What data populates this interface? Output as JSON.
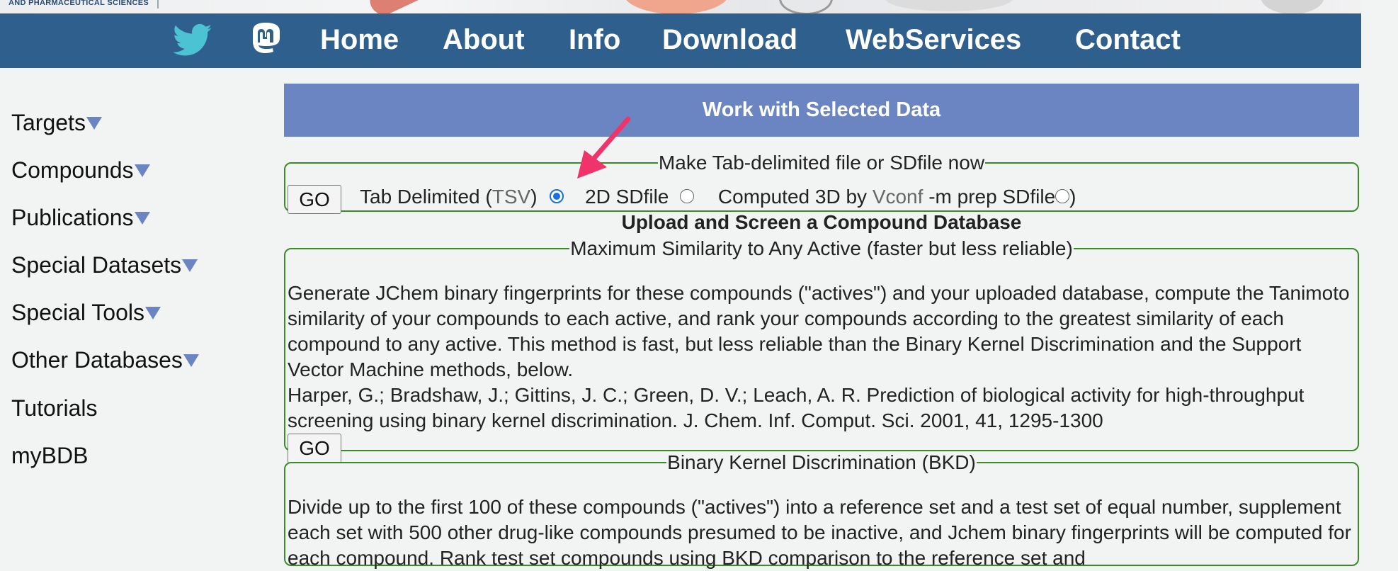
{
  "banner": {
    "logo_text": "AND PHARMACEUTICAL SCIENCES"
  },
  "nav": {
    "social": [
      "twitter-icon",
      "mastodon-icon"
    ],
    "links": [
      "Home",
      "About",
      "Info",
      "Download",
      "WebServices",
      "Contact"
    ]
  },
  "sidebar": {
    "items": [
      {
        "label": "Targets"
      },
      {
        "label": "Compounds"
      },
      {
        "label": "Publications"
      },
      {
        "label": "Special Datasets"
      },
      {
        "label": "Special Tools"
      },
      {
        "label": "Other Databases"
      },
      {
        "label": "Tutorials"
      },
      {
        "label": "myBDB"
      }
    ]
  },
  "main": {
    "header": "Work with Selected Data",
    "make_file": {
      "legend": "Make Tab-delimited file or SDfile now",
      "go": "GO",
      "options": {
        "tsv_prefix": "Tab Delimited (",
        "tsv_abbr": "TSV",
        "tsv_suffix": ")",
        "sdf2d": "2D SDfile",
        "sdf3d_prefix": "Computed 3D by ",
        "sdf3d_tool": "Vconf",
        "sdf3d_suffix": " -m prep SDfile",
        "close_paren": ")"
      },
      "selected": "tsv"
    },
    "upload_title": "Upload and Screen a Compound Database",
    "max_sim": {
      "legend": "Maximum Similarity to Any Active (faster but less reliable)",
      "text": "Generate JChem binary fingerprints for these compounds (\"actives\") and your uploaded database, compute the Tanimoto similarity of your compounds to each active, and rank your compounds according to the greatest similarity of each compound to any active. This method is fast, but less reliable than the Binary Kernel Discrimination and the Support Vector Machine methods, below.",
      "citation": "Harper, G.; Bradshaw, J.; Gittins, J. C.; Green, D. V.; Leach, A. R. Prediction of biological activity for high-throughput screening using binary kernel discrimination. J. Chem. Inf. Comput. Sci. 2001, 41, 1295-1300",
      "go": "GO"
    },
    "bkd": {
      "legend": "Binary Kernel Discrimination (BKD)",
      "text": "Divide up to the first 100 of these compounds (\"actives\") into a reference set and a test set of equal number, supplement each set with 500 other drug-like compounds presumed to be inactive, and Jchem binary fingerprints will be computed for each compound. Rank test set compounds using BKD comparison to the reference set and"
    }
  },
  "colors": {
    "nav_bg": "#2e5f8d",
    "header_bg": "#6b85c2",
    "fieldset_border": "#3a8c28",
    "twitter": "#4cc3d3",
    "arrow": "#f0336a"
  }
}
